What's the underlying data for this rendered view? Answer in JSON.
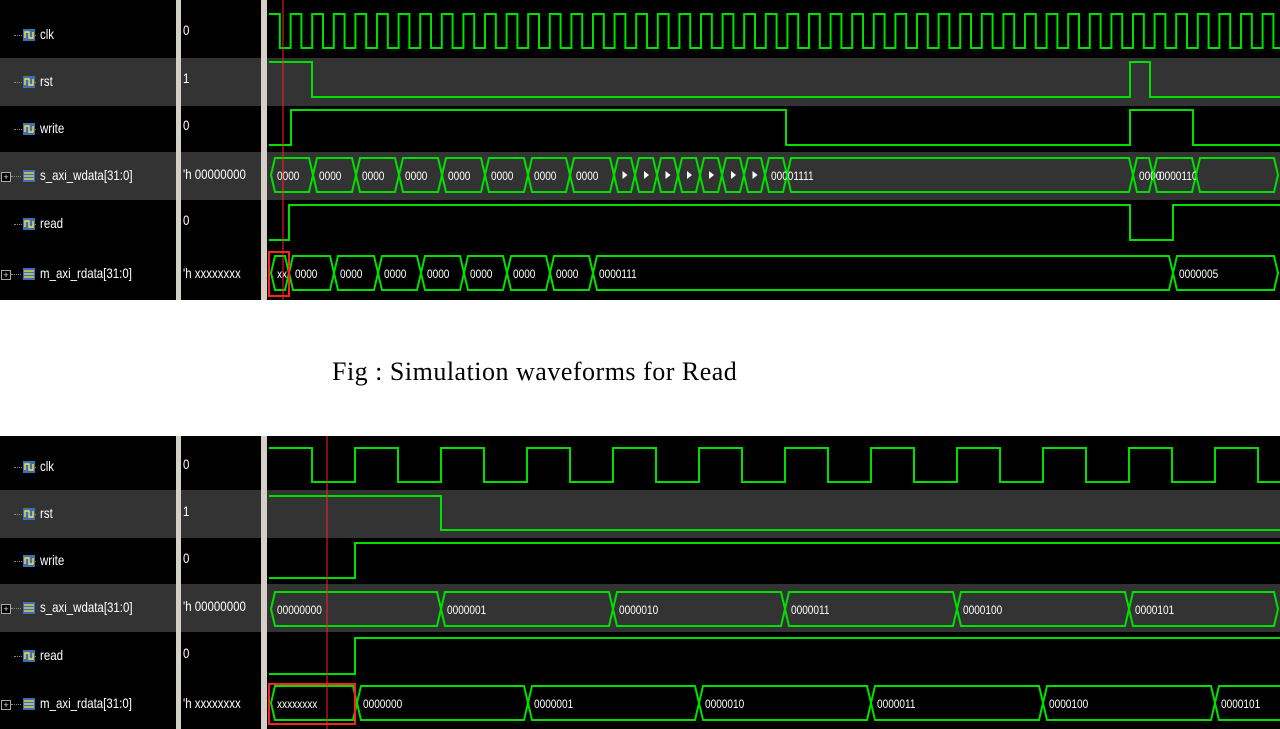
{
  "caption": "Fig : Simulation waveforms for Read",
  "panels": [
    {
      "signals": [
        {
          "name": "clk",
          "value": "0",
          "bus": false
        },
        {
          "name": "rst",
          "value": "1",
          "bus": false
        },
        {
          "name": "write",
          "value": "0",
          "bus": false
        },
        {
          "name": "s_axi_wdata[31:0]",
          "value": "'h 00000000",
          "bus": true,
          "segment_labels": [
            "0000",
            "0000",
            "0000",
            "0000",
            "0000",
            "0000",
            "0000",
            "0000",
            "",
            "",
            "",
            "",
            "",
            "",
            "",
            "00001111",
            "",
            "0000",
            "0000110"
          ]
        },
        {
          "name": "read",
          "value": "0",
          "bus": false
        },
        {
          "name": "m_axi_rdata[31:0]",
          "value": "'h xxxxxxxx",
          "bus": true,
          "segment_labels": [
            "xx",
            "0000",
            "0000",
            "0000",
            "0000",
            "0000",
            "0000",
            "0000",
            "0000111",
            "0000005"
          ]
        }
      ]
    },
    {
      "signals": [
        {
          "name": "clk",
          "value": "0",
          "bus": false
        },
        {
          "name": "rst",
          "value": "1",
          "bus": false
        },
        {
          "name": "write",
          "value": "0",
          "bus": false
        },
        {
          "name": "s_axi_wdata[31:0]",
          "value": "'h 00000000",
          "bus": true,
          "segment_labels": [
            "00000000",
            "0000001",
            "0000010",
            "0000011",
            "0000100",
            "0000101"
          ]
        },
        {
          "name": "read",
          "value": "0",
          "bus": false
        },
        {
          "name": "m_axi_rdata[31:0]",
          "value": "'h xxxxxxxx",
          "bus": true,
          "segment_labels": [
            "xxxxxxxx",
            "0000000",
            "0000001",
            "0000010",
            "0000011",
            "0000100",
            "0000101"
          ]
        }
      ]
    }
  ],
  "colors": {
    "wave": "#00e000",
    "cursor": "#ff2020",
    "frame": "#c00000",
    "row_alt": "#333333"
  }
}
